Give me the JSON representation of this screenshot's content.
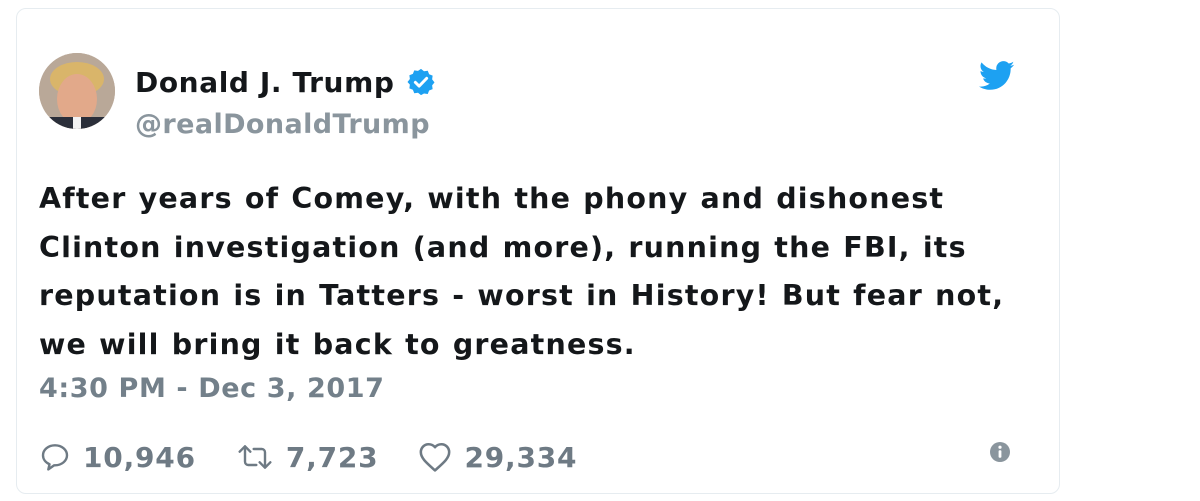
{
  "author": {
    "display_name": "Donald J. Trump",
    "handle": "@realDonaldTrump",
    "verified": true
  },
  "tweet": {
    "text": "After years of Comey, with the phony and dishonest Clinton investigation (and more), running the FBI, its reputation is in Tatters - worst in History! But fear not, we will bring it back to greatness.",
    "timestamp": "4:30 PM - Dec 3, 2017"
  },
  "stats": {
    "replies": "10,946",
    "retweets": "7,723",
    "likes": "29,334"
  },
  "icons": {
    "verified": "verified-badge-icon",
    "brand": "twitter-bird-icon",
    "reply": "reply-icon",
    "retweet": "retweet-icon",
    "like": "heart-icon",
    "info": "info-icon"
  },
  "colors": {
    "twitter_blue": "#1da1f2",
    "text": "#14171a",
    "muted": "#73808a"
  }
}
